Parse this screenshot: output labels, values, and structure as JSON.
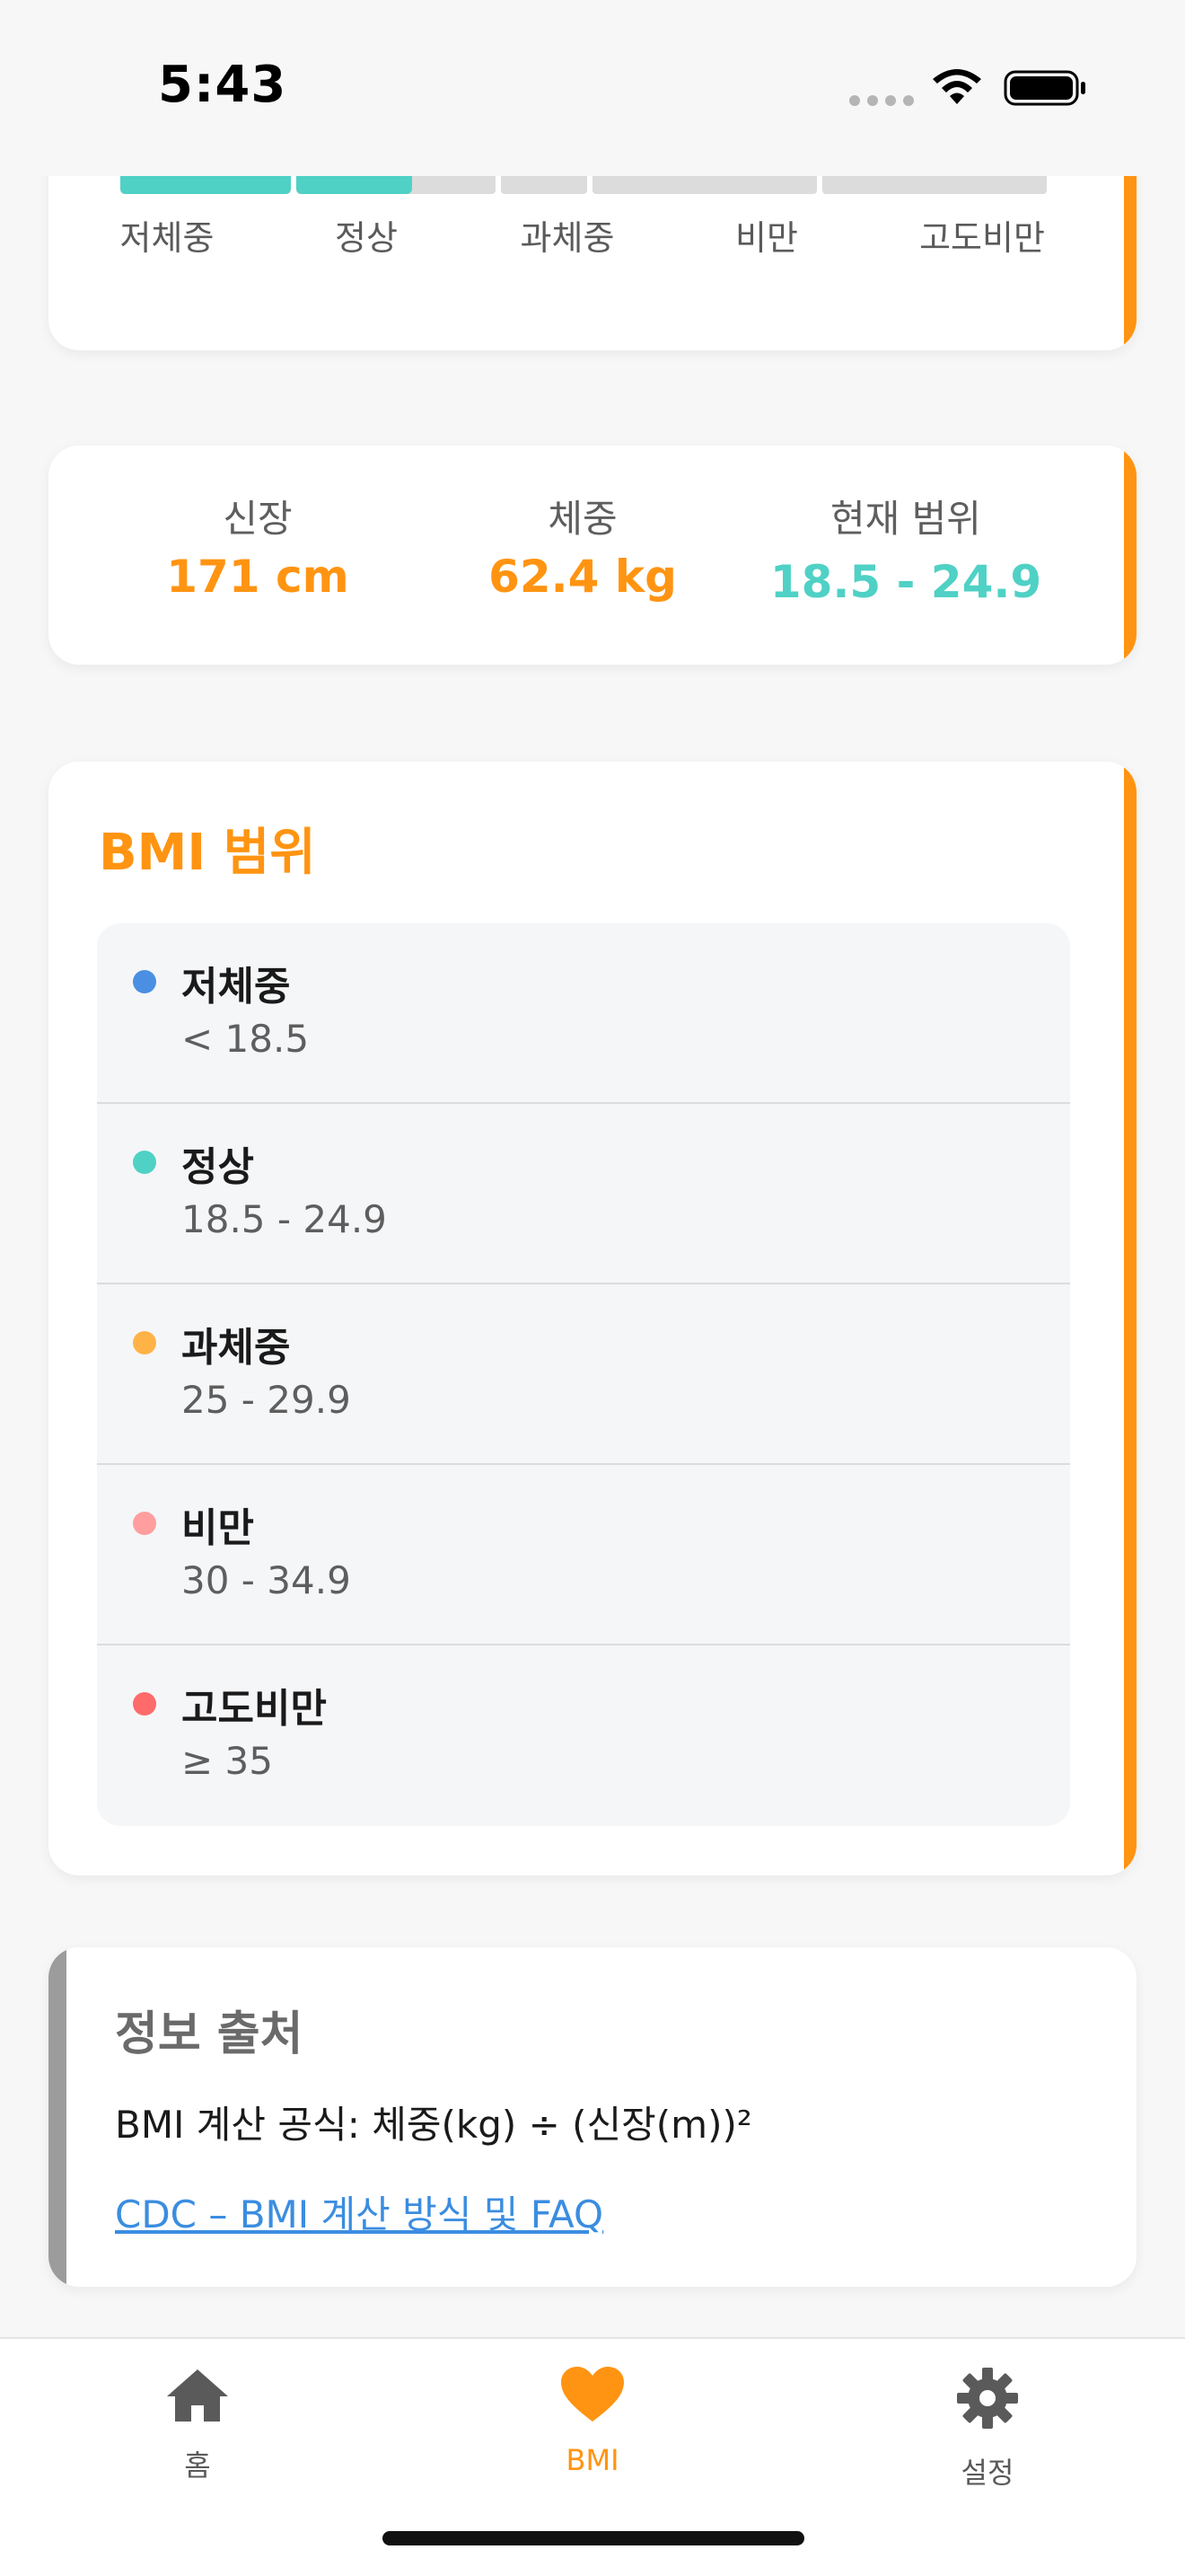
{
  "status_bar": {
    "time": "5:43"
  },
  "scale": {
    "labels": [
      "저체중",
      "정상",
      "과체중",
      "비만",
      "고도비만"
    ]
  },
  "stats": {
    "height": {
      "label": "신장",
      "value": "171 cm"
    },
    "weight": {
      "label": "체중",
      "value": "62.4 kg"
    },
    "range": {
      "label": "현재 범위",
      "value": "18.5 - 24.9"
    }
  },
  "ranges": {
    "title": "BMI 범위",
    "items": [
      {
        "name": "저체중",
        "range": "< 18.5",
        "color": "#4a8fe2"
      },
      {
        "name": "정상",
        "range": "18.5 - 24.9",
        "color": "#4fd1c5"
      },
      {
        "name": "과체중",
        "range": "25 - 29.9",
        "color": "#ffb347"
      },
      {
        "name": "비만",
        "range": "30 - 34.9",
        "color": "#ff9e9e"
      },
      {
        "name": "고도비만",
        "range": "≥ 35",
        "color": "#ff6b6b"
      }
    ]
  },
  "info": {
    "title": "정보 출처",
    "formula": "BMI 계산 공식: 체중(kg) ÷ (신장(m))²",
    "link": "CDC – BMI 계산 방식 및 FAQ"
  },
  "tabs": [
    {
      "label": "홈",
      "icon": "home-icon"
    },
    {
      "label": "BMI",
      "icon": "heart-icon"
    },
    {
      "label": "설정",
      "icon": "gear-icon"
    }
  ],
  "colors": {
    "accent": "#ff9412",
    "teal": "#4fd1c5",
    "link": "#3b8de0"
  }
}
